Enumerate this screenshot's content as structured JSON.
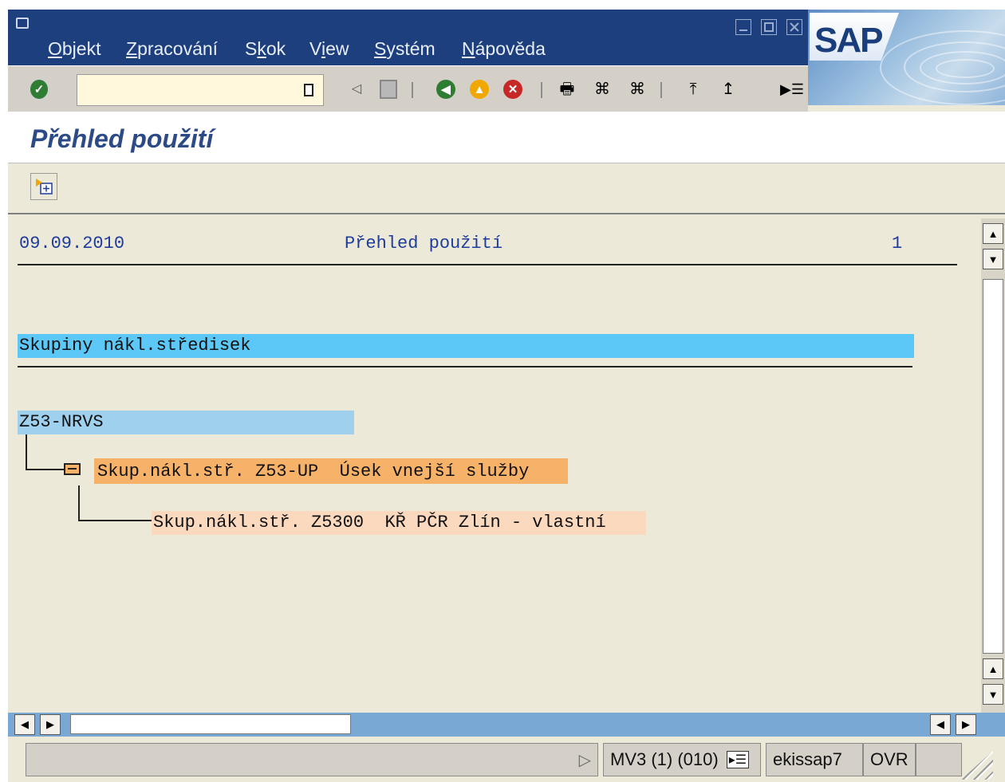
{
  "menubar": {
    "items": [
      {
        "label": "Objekt"
      },
      {
        "label": "Zpracování"
      },
      {
        "label": "Skok"
      },
      {
        "label": "View"
      },
      {
        "label": "Systém"
      },
      {
        "label": "Nápověda"
      }
    ],
    "logo_text": "SAP"
  },
  "toolbar": {
    "command_field_value": "",
    "icons": [
      "enter-icon",
      "command-list-icon",
      "back-arrow-icon",
      "save-icon",
      "back-icon",
      "exit-icon",
      "cancel-icon",
      "print-icon",
      "find-icon",
      "find-next-icon",
      "first-page-icon",
      "previous-page-icon",
      "layout-menu-icon"
    ]
  },
  "page": {
    "title": "Přehled použití"
  },
  "report": {
    "date": "09.09.2010",
    "heading": "Přehled použití",
    "page_number": "1",
    "section_title": "Skupiny nákl.středisek",
    "root_node": "Z53-NRVS",
    "child_node": "Skup.nákl.stř. Z53-UP  Úsek vnejší služby",
    "grandchild_node": "Skup.nákl.stř. Z5300  KŘ PČR Zlín - vlastní"
  },
  "status_bar": {
    "system": "MV3 (1) (010)",
    "server": "ekissap7",
    "mode": "OVR"
  },
  "colors": {
    "menubar_bg": "#1e3f7e",
    "title_text": "#2c4a86",
    "section_highlight": "#5bc8f8",
    "root_highlight": "#9fd0ee",
    "child_highlight": "#f7b26a",
    "grandchild_highlight": "#fbd9bf"
  }
}
